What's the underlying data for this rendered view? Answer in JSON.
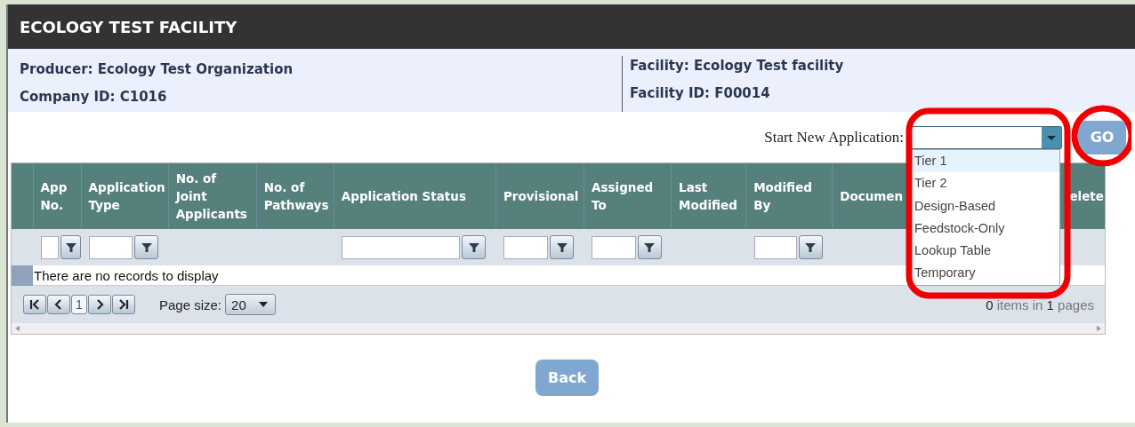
{
  "header": {
    "title": "ECOLOGY TEST FACILITY"
  },
  "info": {
    "left": [
      "Producer: Ecology Test Organization",
      "Company ID: C1016"
    ],
    "right": [
      "Facility: Ecology Test facility",
      "Facility ID: F00014"
    ]
  },
  "start_application": {
    "label": "Start New Application:",
    "options": [
      {
        "label": "Tier 1",
        "selected": true
      },
      {
        "label": "Tier 2",
        "selected": false
      },
      {
        "label": "Design-Based",
        "selected": false
      },
      {
        "label": "Feedstock-Only",
        "selected": false
      },
      {
        "label": "Lookup Table",
        "selected": false
      },
      {
        "label": "Temporary",
        "selected": false
      }
    ],
    "go_button": "GO"
  },
  "table": {
    "columns": [
      {
        "label": "App No.",
        "filter": true
      },
      {
        "label": "Application Type",
        "filter": true
      },
      {
        "label": "No. of Joint Applicants",
        "filter": false
      },
      {
        "label": "No. of Pathways",
        "filter": false
      },
      {
        "label": "Application Status",
        "filter": true
      },
      {
        "label": "Provisional",
        "filter": true
      },
      {
        "label": "Assigned To",
        "filter": true
      },
      {
        "label": "Last Modified",
        "filter": false
      },
      {
        "label": "Modified By",
        "filter": true
      },
      {
        "label": "Documen",
        "filter": false
      },
      {
        "label": "elete",
        "filter": false
      }
    ],
    "empty_message": "There are no records to display",
    "pager": {
      "current_page": "1",
      "page_size_label": "Page size:",
      "page_size": "20",
      "summary": "**0** items in **1** pages"
    }
  },
  "back_button": "Back"
}
